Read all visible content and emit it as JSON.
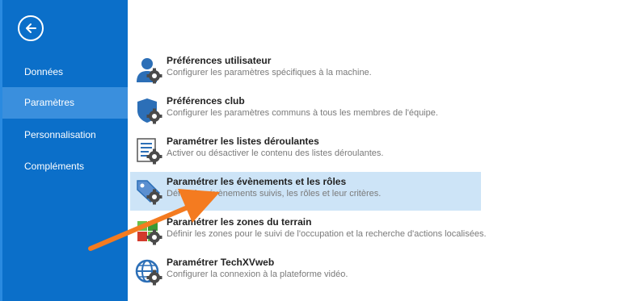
{
  "sidebar": {
    "back_label": "",
    "items": [
      {
        "label": "Données",
        "active": false
      },
      {
        "label": "Paramètres",
        "active": true
      },
      {
        "label": "Personnalisation",
        "active": false
      },
      {
        "label": "Compléments",
        "active": false
      }
    ]
  },
  "options": [
    {
      "title": "Préférences utilisateur",
      "description": "Configurer les paramètres spécifiques à la machine.",
      "icon": "user-settings-icon"
    },
    {
      "title": "Préférences club",
      "description": "Configurer les paramètres communs à tous les membres de l'équipe.",
      "icon": "shield-settings-icon"
    },
    {
      "title": "Paramétrer les listes déroulantes",
      "description": "Activer ou désactiver le contenu des listes déroulantes.",
      "icon": "list-settings-icon"
    },
    {
      "title": "Paramétrer les évènements et les rôles",
      "description": "Définir les évènements suivis, les rôles et leur critères.",
      "icon": "tag-settings-icon",
      "selected": true
    },
    {
      "title": "Paramétrer les zones du terrain",
      "description": "Définir les zones pour le suivi de l'occupation et la recherche d'actions localisées.",
      "icon": "field-zones-icon"
    },
    {
      "title": "Paramétrer TechXVweb",
      "description": "Configurer la connexion à la plateforme vidéo.",
      "icon": "globe-settings-icon"
    }
  ],
  "colors": {
    "sidebar": "#0b6fc9",
    "sidebar_active": "#3a8fdd",
    "selected_row": "#cde4f7",
    "arrow": "#f47b20",
    "icon_blue": "#2c6fb7"
  }
}
